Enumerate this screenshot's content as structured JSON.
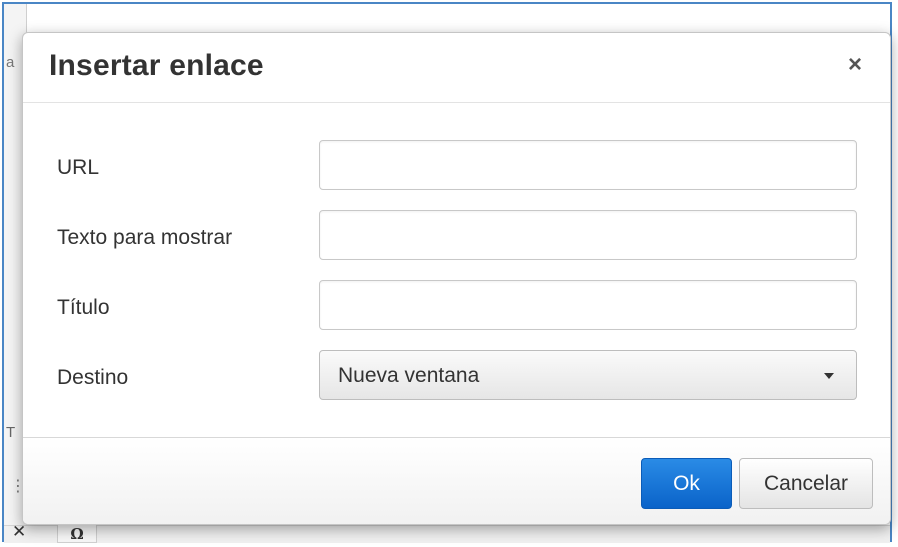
{
  "background": {
    "left_partial_top": "a",
    "left_partial_mid": "T",
    "left_dots": "⋮",
    "close_glyph": "✕",
    "omega_button": "Ω"
  },
  "dialog": {
    "title": "Insertar enlace",
    "close_glyph": "×",
    "fields": {
      "url": {
        "label": "URL",
        "value": ""
      },
      "text": {
        "label": "Texto para mostrar",
        "value": ""
      },
      "title": {
        "label": "Título",
        "value": ""
      },
      "target": {
        "label": "Destino",
        "selected": "Nueva ventana"
      }
    },
    "buttons": {
      "ok": "Ok",
      "cancel": "Cancelar"
    }
  },
  "colors": {
    "frame_border": "#4a86c5",
    "primary_button": "#0a63c9",
    "text": "#333333"
  }
}
